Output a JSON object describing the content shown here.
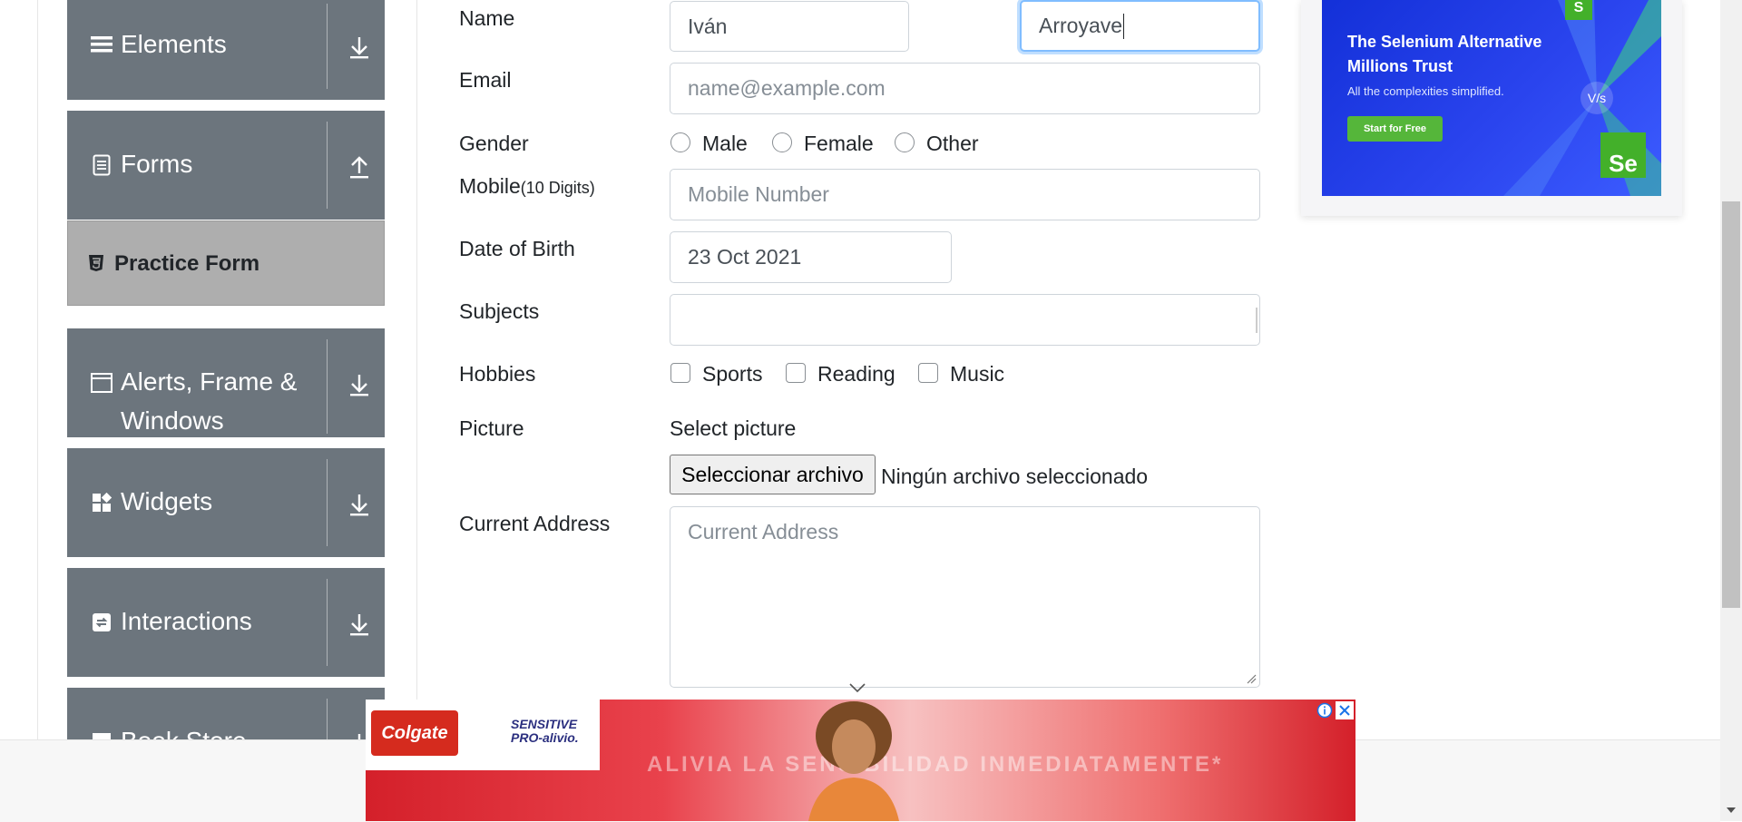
{
  "sidebar": {
    "groups": [
      {
        "label": "Elements"
      },
      {
        "label": "Forms"
      },
      {
        "label_line1": "Alerts, Frame &",
        "label_line2": "Windows"
      },
      {
        "label": "Widgets"
      },
      {
        "label": "Interactions"
      },
      {
        "label": "Book Store"
      }
    ],
    "active_item": "Practice Form"
  },
  "form": {
    "name_label": "Name",
    "first_name_value": "Iván",
    "last_name_value": "Arroyave",
    "email_label": "Email",
    "email_placeholder": "name@example.com",
    "gender_label": "Gender",
    "gender_options": [
      "Male",
      "Female",
      "Other"
    ],
    "mobile_label": "Mobile",
    "mobile_hint": "(10 Digits)",
    "mobile_placeholder": "Mobile Number",
    "dob_label": "Date of Birth",
    "dob_value": "23 Oct 2021",
    "subjects_label": "Subjects",
    "hobbies_label": "Hobbies",
    "hobbies_options": [
      "Sports",
      "Reading",
      "Music"
    ],
    "picture_label": "Picture",
    "picture_prompt": "Select picture",
    "file_button": "Seleccionar archivo",
    "file_status": "Ningún archivo seleccionado",
    "address_label": "Current Address",
    "address_placeholder": "Current Address"
  },
  "ads": {
    "selenium": {
      "headline_line1": "The Selenium Alternative",
      "headline_line2": "Millions Trust",
      "subtext": "All the complexities simplified.",
      "cta": "Start for Free",
      "badge": "Se",
      "logo": "S",
      "vs": "V/s"
    },
    "colgate": {
      "brand": "Colgate",
      "product_line1": "SENSITIVE",
      "product_line2": "PRO-alivio.",
      "slogan": "ALIVIA LA SENSIBILIDAD INMEDIATAMENTE*"
    }
  },
  "colors": {
    "sidebar_bg": "#6c757d",
    "active_item_bg": "#aeaeae",
    "focus_border": "#80bdff"
  }
}
